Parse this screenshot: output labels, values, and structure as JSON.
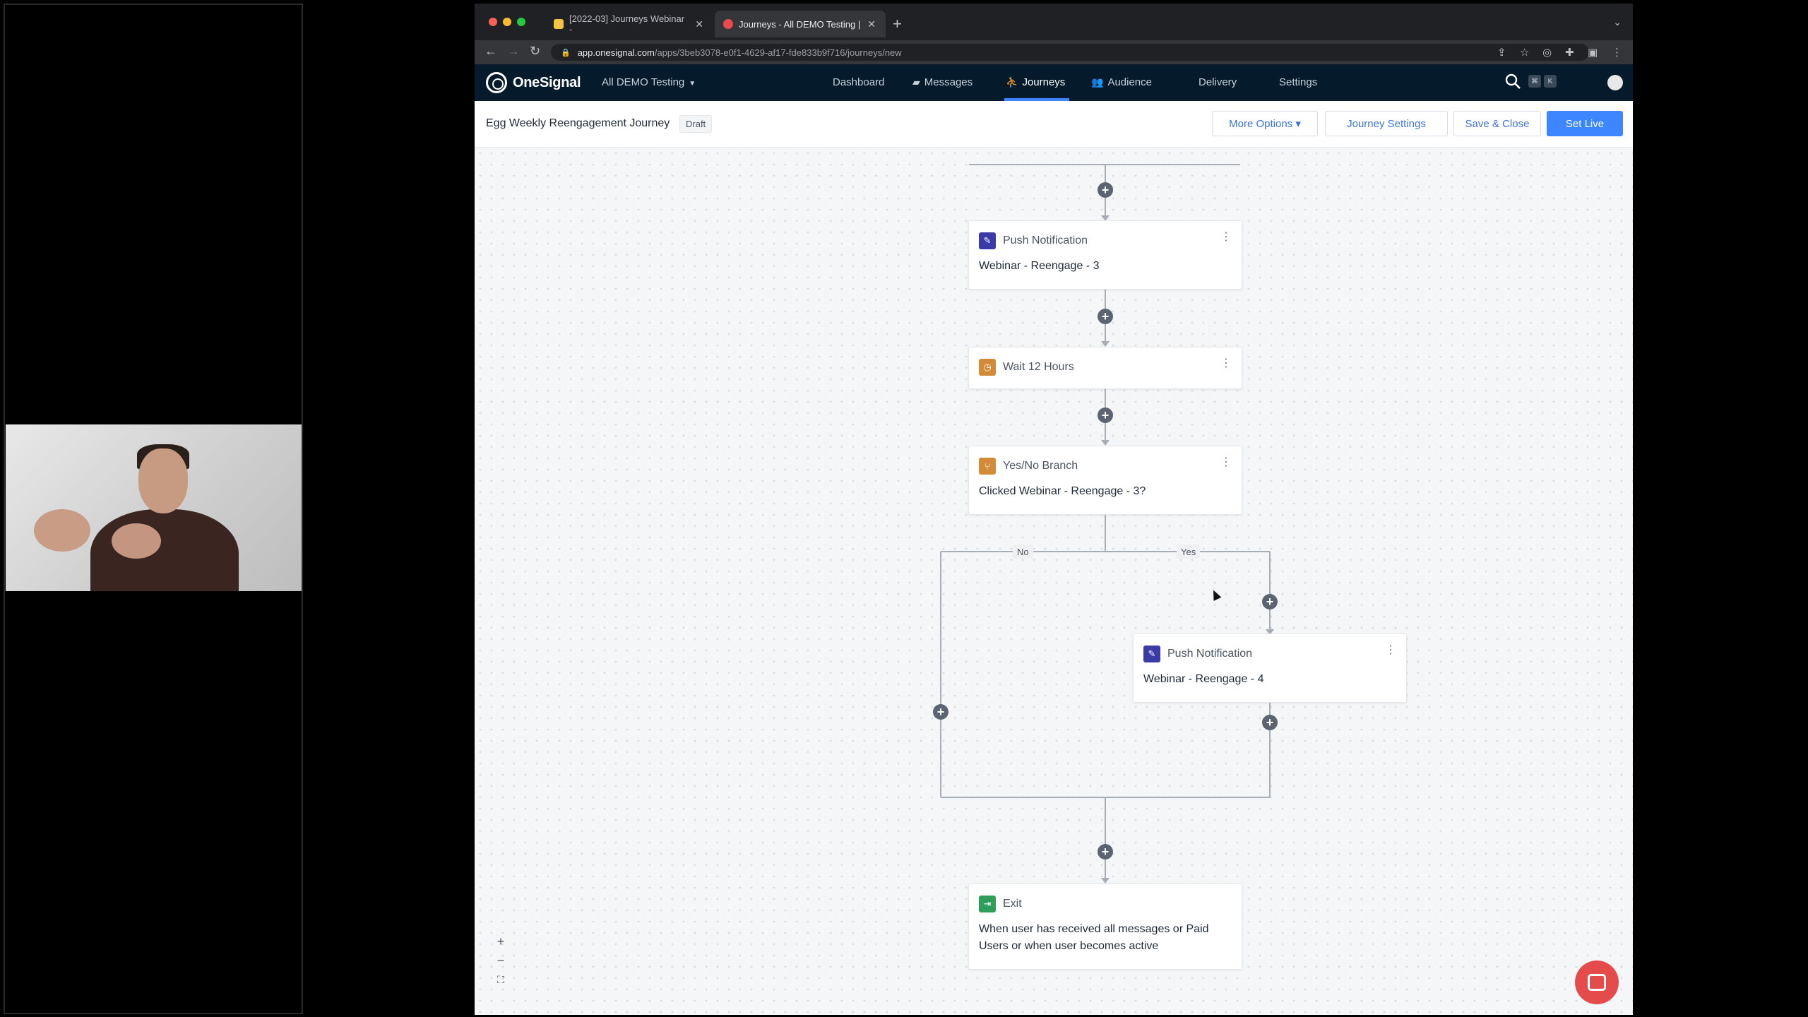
{
  "browser": {
    "tabs": [
      {
        "label": "[2022-03] Journeys Webinar -",
        "active": false
      },
      {
        "label": "Journeys - All DEMO Testing | ",
        "active": true
      }
    ],
    "url_host": "app.onesignal.com",
    "url_path": "/apps/3beb3078-e0f1-4629-af17-fde833b9f716/journeys/new"
  },
  "nav": {
    "logo_text": "OneSignal",
    "app_name": "All DEMO Testing",
    "items": {
      "dashboard": "Dashboard",
      "messages": "Messages",
      "journeys": "Journeys",
      "audience": "Audience",
      "delivery": "Delivery",
      "settings": "Settings"
    },
    "active_item": "Journeys",
    "shortcut_keys": [
      "⌘",
      "K"
    ]
  },
  "journey": {
    "title": "Egg Weekly Reengagement Journey",
    "status": "Draft",
    "buttons": {
      "more_options": "More Options ▾",
      "journey_settings": "Journey Settings",
      "save_close": "Save & Close",
      "set_live": "Set Live"
    }
  },
  "nodes": {
    "push1": {
      "type": "Push Notification",
      "body": "Webinar - Reengage - 3"
    },
    "wait": {
      "type": "Wait 12 Hours"
    },
    "branch": {
      "type": "Yes/No Branch",
      "body": "Clicked Webinar - Reengage - 3?",
      "no_label": "No",
      "yes_label": "Yes"
    },
    "push2": {
      "type": "Push Notification",
      "body": "Webinar - Reengage - 4"
    },
    "exit": {
      "type": "Exit",
      "body": "When user has received all messages or Paid Users or when user becomes active"
    }
  },
  "zoom_controls": {
    "zoom_in": "+",
    "zoom_out": "−",
    "fit": "⛶"
  },
  "colors": {
    "accent": "#3d86ff",
    "nav_bg": "#051b2c",
    "push_icon": "#3b3ba8",
    "wait_icon": "#d38b3a",
    "exit_icon": "#2f9e5b",
    "chat": "#e54b4b"
  }
}
